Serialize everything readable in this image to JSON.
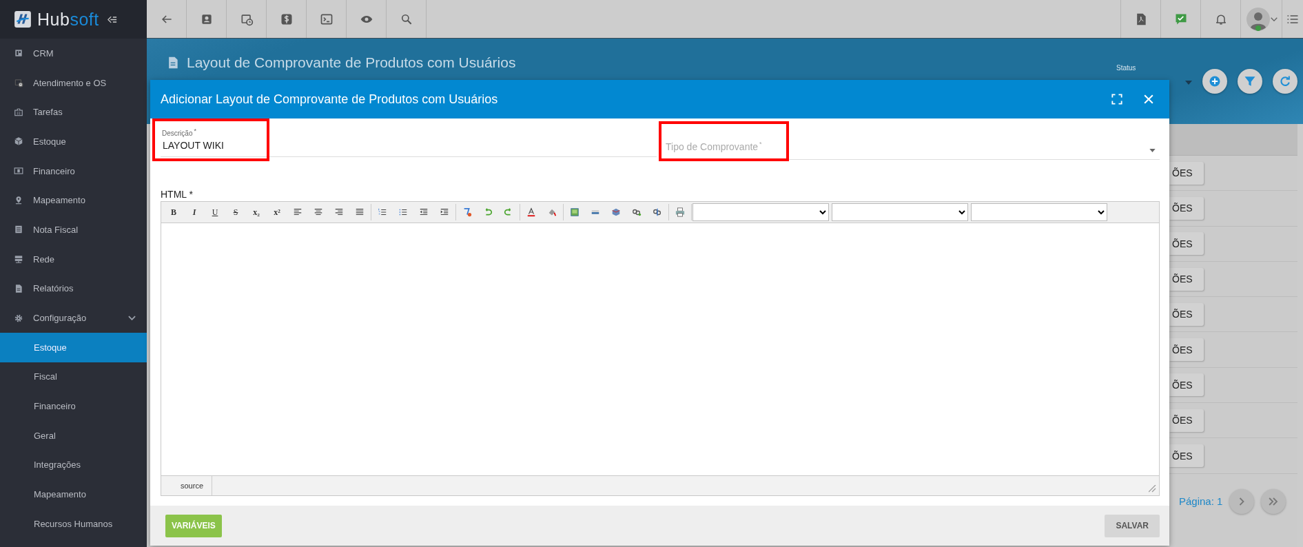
{
  "app": {
    "logo": {
      "main": "Hub",
      "accent": "soft"
    }
  },
  "sidebar": {
    "items": [
      {
        "label": "CRM",
        "selected": false
      },
      {
        "label": "Atendimento e OS",
        "selected": false
      },
      {
        "label": "Tarefas",
        "selected": false
      },
      {
        "label": "Estoque",
        "selected": false
      },
      {
        "label": "Financeiro",
        "selected": false
      },
      {
        "label": "Mapeamento",
        "selected": false
      },
      {
        "label": "Nota Fiscal",
        "selected": false
      },
      {
        "label": "Rede",
        "selected": false
      },
      {
        "label": "Relatórios",
        "selected": false
      },
      {
        "label": "Configuração",
        "selected": false,
        "expanded": true,
        "children": [
          {
            "label": "Estoque",
            "selected": true
          },
          {
            "label": "Fiscal",
            "selected": false
          },
          {
            "label": "Financeiro",
            "selected": false
          },
          {
            "label": "Geral",
            "selected": false
          },
          {
            "label": "Integrações",
            "selected": false
          },
          {
            "label": "Mapeamento",
            "selected": false
          },
          {
            "label": "Recursos Humanos",
            "selected": false
          }
        ]
      }
    ]
  },
  "page": {
    "title": "Layout de Comprovante de Produtos com Usuários",
    "status_label": "Status",
    "row_actions": [
      "ÕES",
      "ÕES",
      "ÕES",
      "ÕES",
      "ÕES",
      "ÕES",
      "ÕES",
      "ÕES",
      "ÕES"
    ],
    "pagination": {
      "page": "Página: 1"
    }
  },
  "dialog": {
    "title": "Adicionar Layout de Comprovante de Produtos com Usuários",
    "fields": [
      {
        "kind": "text",
        "label": "Descrição",
        "required_mark": "*",
        "value": "LAYOUT WIKI",
        "highlighted": true
      },
      {
        "kind": "select",
        "placeholder": "Tipo de Comprovante",
        "required_mark": "*",
        "highlighted": true
      }
    ],
    "editor": {
      "label": "HTML *",
      "format_buttons": [
        "B",
        "I",
        "U",
        "S",
        "x₂",
        "x²"
      ],
      "status_tab": "source"
    },
    "buttons": [
      {
        "kind": "variables",
        "label": "VARIÁVEIS",
        "disabled": false
      },
      {
        "kind": "save",
        "label": "SALVAR",
        "disabled": true
      }
    ]
  }
}
